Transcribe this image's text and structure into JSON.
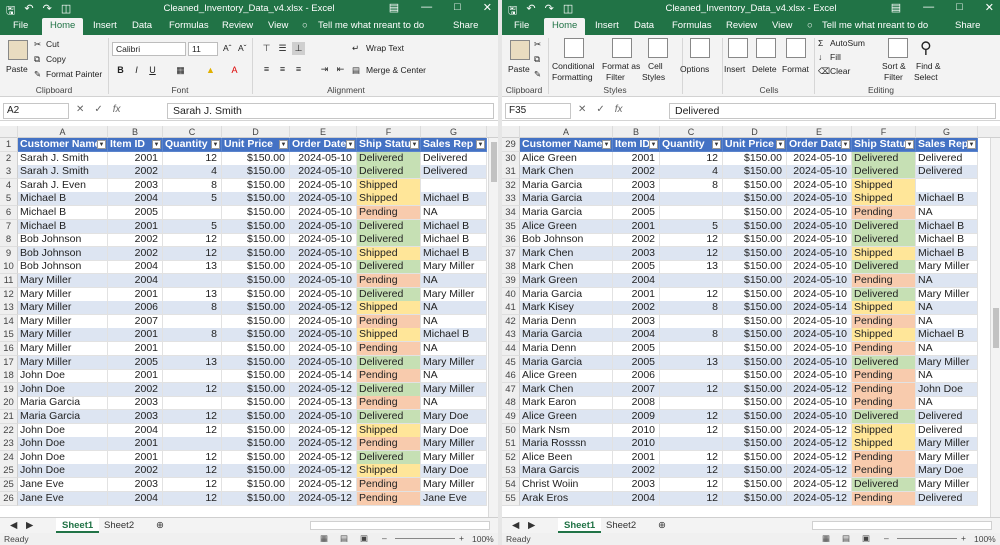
{
  "app": {
    "title": "Cleaned_Inventory_Data_v4.xlsx - Excel",
    "tabs": [
      "File",
      "Home",
      "Insert",
      "Data",
      "Formulas",
      "Review",
      "View"
    ],
    "tabs_right": [
      "File",
      "Home",
      "Insert",
      "Data",
      "Formulas",
      "Review",
      "View"
    ],
    "tell_me": "Tell me what nreant to do",
    "share": "Share",
    "status_ready": "Ready",
    "zoom": "100%",
    "sheet_tabs": [
      "Sheet1",
      "Sheet2"
    ]
  },
  "ribbon_left": {
    "paste": "Paste",
    "cut": "Cut",
    "copy": "Copy",
    "format_painter": "Format Painter",
    "clipboard": "Clipboard",
    "font_name": "Calibri",
    "font_size": "11",
    "font": "Font",
    "wrap_text": "Wrap Text",
    "merge_center": "Merge & Center",
    "alignment": "Alignment",
    "bold": "B",
    "italic": "I",
    "underline": "U"
  },
  "ribbon_right": {
    "paste": "Paste",
    "clipboard": "Clipboard",
    "conditional": "Conditional",
    "formatting": "Formatting",
    "format_as": "Format as",
    "filter": "Filter",
    "cell": "Cell",
    "styles_btn": "Styles",
    "styles": "Styles",
    "options": "Options",
    "insert": "Insert",
    "delete": "Delete",
    "format": "Format",
    "cells": "Cells",
    "autosum": "AutoSum",
    "fill": "Fill",
    "clear": "Clear",
    "sort": "Sort &",
    "filter2": "Filter",
    "find": "Find &",
    "select": "Select",
    "editing": "Editing"
  },
  "left_pane": {
    "name_box": "A2",
    "formula_value": "Sarah J. Smith",
    "columns": [
      "A",
      "B",
      "C",
      "D",
      "E",
      "F",
      "G"
    ],
    "headers": [
      "Customer Name",
      "Item ID",
      "Quantity",
      "Unit Price",
      "Order Date",
      "Ship Status",
      "Sales Rep"
    ],
    "rows": [
      {
        "n": "2",
        "name": "Sarah J. Smith",
        "id": "2001",
        "qty": "12",
        "price": "$150.00",
        "date": "2024-05-10",
        "status": "Delivered",
        "rep": "Delivered"
      },
      {
        "n": "3",
        "name": "Sarah J. Smith",
        "id": "2002",
        "qty": "4",
        "price": "$150.00",
        "date": "2024-05-10",
        "status": "Delivered",
        "rep": "Delivered"
      },
      {
        "n": "4",
        "name": "Sarah J. Even",
        "id": "2003",
        "qty": "8",
        "price": "$150.00",
        "date": "2024-05-10",
        "status": "Shipped",
        "rep": ""
      },
      {
        "n": "5",
        "name": "Michael B",
        "id": "2004",
        "qty": "5",
        "price": "$150.00",
        "date": "2024-05-10",
        "status": "Shipped",
        "rep": "Michael B"
      },
      {
        "n": "6",
        "name": "Michael B",
        "id": "2005",
        "qty": "",
        "price": "$150.00",
        "date": "2024-05-10",
        "status": "Pending",
        "rep": "NA"
      },
      {
        "n": "7",
        "name": "Michael B",
        "id": "2001",
        "qty": "5",
        "price": "$150.00",
        "date": "2024-05-10",
        "status": "Delivered",
        "rep": "Michael B"
      },
      {
        "n": "8",
        "name": "Bob Johnson",
        "id": "2002",
        "qty": "12",
        "price": "$150.00",
        "date": "2024-05-10",
        "status": "Delivered",
        "rep": "Michael B"
      },
      {
        "n": "9",
        "name": "Bob Johnson",
        "id": "2002",
        "qty": "12",
        "price": "$150.00",
        "date": "2024-05-10",
        "status": "Shipped",
        "rep": "Michael B"
      },
      {
        "n": "10",
        "name": "Bob Johnson",
        "id": "2004",
        "qty": "13",
        "price": "$150.00",
        "date": "2024-05-10",
        "status": "Delivered",
        "rep": "Mary Miller"
      },
      {
        "n": "11",
        "name": "Mary Miller",
        "id": "2004",
        "qty": "",
        "price": "$150.00",
        "date": "2024-05-10",
        "status": "Pending",
        "rep": "NA"
      },
      {
        "n": "12",
        "name": "Mary Miller",
        "id": "2001",
        "qty": "13",
        "price": "$150.00",
        "date": "2024-05-10",
        "status": "Delivered",
        "rep": "Mary Miller"
      },
      {
        "n": "13",
        "name": "Mary Miller",
        "id": "2006",
        "qty": "8",
        "price": "$150.00",
        "date": "2024-05-12",
        "status": "Shipped",
        "rep": "NA"
      },
      {
        "n": "14",
        "name": "Mary Miller",
        "id": "2007",
        "qty": "",
        "price": "$150.00",
        "date": "2024-05-10",
        "status": "Pending",
        "rep": "NA"
      },
      {
        "n": "15",
        "name": "Mary Miller",
        "id": "2001",
        "qty": "8",
        "price": "$150.00",
        "date": "2024-05-10",
        "status": "Shipped",
        "rep": "Michael B"
      },
      {
        "n": "16",
        "name": "Mary Miller",
        "id": "2001",
        "qty": "",
        "price": "$150.00",
        "date": "2024-05-10",
        "status": "Pending",
        "rep": "NA"
      },
      {
        "n": "17",
        "name": "Mary Miller",
        "id": "2005",
        "qty": "13",
        "price": "$150.00",
        "date": "2024-05-10",
        "status": "Delivered",
        "rep": "Mary Miller"
      },
      {
        "n": "18",
        "name": "John Doe",
        "id": "2001",
        "qty": "",
        "price": "$150.00",
        "date": "2024-05-14",
        "status": "Pending",
        "rep": "NA"
      },
      {
        "n": "19",
        "name": "John Doe",
        "id": "2002",
        "qty": "12",
        "price": "$150.00",
        "date": "2024-05-12",
        "status": "Delivered",
        "rep": "Mary Miller"
      },
      {
        "n": "20",
        "name": "Maria Garcia",
        "id": "2003",
        "qty": "",
        "price": "$150.00",
        "date": "2024-05-13",
        "status": "Pending",
        "rep": "NA"
      },
      {
        "n": "21",
        "name": "Maria Garcia",
        "id": "2003",
        "qty": "12",
        "price": "$150.00",
        "date": "2024-05-10",
        "status": "Delivered",
        "rep": "Mary Doe"
      },
      {
        "n": "22",
        "name": "John Doe",
        "id": "2004",
        "qty": "12",
        "price": "$150.00",
        "date": "2024-05-12",
        "status": "Shipped",
        "rep": "Mary Doe"
      },
      {
        "n": "23",
        "name": "John Doe",
        "id": "2001",
        "qty": "",
        "price": "$150.00",
        "date": "2024-05-12",
        "status": "Pending",
        "rep": "Mary Miller"
      },
      {
        "n": "24",
        "name": "John Doe",
        "id": "2001",
        "qty": "12",
        "price": "$150.00",
        "date": "2024-05-12",
        "status": "Delivered",
        "rep": "Mary Miller"
      },
      {
        "n": "25",
        "name": "John Doe",
        "id": "2002",
        "qty": "12",
        "price": "$150.00",
        "date": "2024-05-12",
        "status": "Shipped",
        "rep": "Mary Doe"
      },
      {
        "n": "25",
        "name": "Jane Eve",
        "id": "2003",
        "qty": "12",
        "price": "$150.00",
        "date": "2024-05-12",
        "status": "Pending",
        "rep": "Mary Miller"
      },
      {
        "n": "26",
        "name": "Jane Eve",
        "id": "2004",
        "qty": "12",
        "price": "$150.00",
        "date": "2024-05-12",
        "status": "Pending",
        "rep": "Jane Eve"
      }
    ]
  },
  "right_pane": {
    "name_box": "F35",
    "formula_value": "Delivered",
    "columns": [
      "A",
      "B",
      "C",
      "D",
      "E",
      "F",
      "G"
    ],
    "headers": [
      "Customer Name",
      "Item ID",
      "Quantity",
      "Unit Price",
      "Order Date",
      "Ship Status",
      "Sales Rep"
    ],
    "rows": [
      {
        "n": "30",
        "name": "Alice Green",
        "id": "2001",
        "qty": "12",
        "price": "$150.00",
        "date": "2024-05-10",
        "status": "Delivered",
        "rep": "Delivered"
      },
      {
        "n": "31",
        "name": "Mark Chen",
        "id": "2002",
        "qty": "4",
        "price": "$150.00",
        "date": "2024-05-10",
        "status": "Delivered",
        "rep": "Delivered"
      },
      {
        "n": "32",
        "name": "Maria Garcia",
        "id": "2003",
        "qty": "8",
        "price": "$150.00",
        "date": "2024-05-10",
        "status": "Shipped",
        "rep": ""
      },
      {
        "n": "33",
        "name": "Maria Garcia",
        "id": "2004",
        "qty": "",
        "price": "$150.00",
        "date": "2024-05-10",
        "status": "Shipped",
        "rep": "Michael B"
      },
      {
        "n": "34",
        "name": "Maria Garcia",
        "id": "2005",
        "qty": "",
        "price": "$150.00",
        "date": "2024-05-10",
        "status": "Pending",
        "rep": "NA"
      },
      {
        "n": "35",
        "name": "Alice Green",
        "id": "2001",
        "qty": "5",
        "price": "$150.00",
        "date": "2024-05-10",
        "status": "Delivered",
        "rep": "Michael B"
      },
      {
        "n": "36",
        "name": "Bob Johnson",
        "id": "2002",
        "qty": "12",
        "price": "$150.00",
        "date": "2024-05-10",
        "status": "Delivered",
        "rep": "Michael B"
      },
      {
        "n": "37",
        "name": "Mark Chen",
        "id": "2003",
        "qty": "12",
        "price": "$150.00",
        "date": "2024-05-10",
        "status": "Shipped",
        "rep": "Michael B"
      },
      {
        "n": "38",
        "name": "Mark Chen",
        "id": "2005",
        "qty": "13",
        "price": "$150.00",
        "date": "2024-05-10",
        "status": "Delivered",
        "rep": "Mary Miller"
      },
      {
        "n": "39",
        "name": "Mark Green",
        "id": "2004",
        "qty": "",
        "price": "$150.00",
        "date": "2024-05-10",
        "status": "Pending",
        "rep": "NA"
      },
      {
        "n": "40",
        "name": "Maria Garcia",
        "id": "2001",
        "qty": "12",
        "price": "$150.00",
        "date": "2024-05-10",
        "status": "Delivered",
        "rep": "Mary Miller"
      },
      {
        "n": "41",
        "name": "Mark Kisey",
        "id": "2002",
        "qty": "8",
        "price": "$150.00",
        "date": "2024-05-14",
        "status": "Shipped",
        "rep": "NA"
      },
      {
        "n": "42",
        "name": "Maria Denn",
        "id": "2003",
        "qty": "",
        "price": "$150.00",
        "date": "2024-05-10",
        "status": "Pending",
        "rep": "NA"
      },
      {
        "n": "43",
        "name": "Maria Garcia",
        "id": "2004",
        "qty": "8",
        "price": "$150.00",
        "date": "2024-05-10",
        "status": "Shipped",
        "rep": "Michael B"
      },
      {
        "n": "44",
        "name": "Maria Denn",
        "id": "2005",
        "qty": "",
        "price": "$150.00",
        "date": "2024-05-10",
        "status": "Pending",
        "rep": "NA"
      },
      {
        "n": "45",
        "name": "Maria Garcia",
        "id": "2005",
        "qty": "13",
        "price": "$150.00",
        "date": "2024-05-10",
        "status": "Delivered",
        "rep": "Mary Miller"
      },
      {
        "n": "46",
        "name": "Alice Green",
        "id": "2006",
        "qty": "",
        "price": "$150.00",
        "date": "2024-05-10",
        "status": "Pending",
        "rep": "NA"
      },
      {
        "n": "47",
        "name": "Mark Chen",
        "id": "2007",
        "qty": "12",
        "price": "$150.00",
        "date": "2024-05-12",
        "status": "Pending",
        "rep": "John Doe"
      },
      {
        "n": "48",
        "name": "Mark Earon",
        "id": "2008",
        "qty": "",
        "price": "$150.00",
        "date": "2024-05-10",
        "status": "Pending",
        "rep": "NA"
      },
      {
        "n": "49",
        "name": "Alice Green",
        "id": "2009",
        "qty": "12",
        "price": "$150.00",
        "date": "2024-05-10",
        "status": "Delivered",
        "rep": "Delivered"
      },
      {
        "n": "50",
        "name": "Mark Nsm",
        "id": "2010",
        "qty": "12",
        "price": "$150.00",
        "date": "2024-05-12",
        "status": "Shipped",
        "rep": "Delivered"
      },
      {
        "n": "51",
        "name": "Maria Rosssn",
        "id": "2010",
        "qty": "",
        "price": "$150.00",
        "date": "2024-05-12",
        "status": "Shipped",
        "rep": "Mary Miller"
      },
      {
        "n": "52",
        "name": "Alice Been",
        "id": "2001",
        "qty": "12",
        "price": "$150.00",
        "date": "2024-05-12",
        "status": "Pending",
        "rep": "Mary Miller"
      },
      {
        "n": "53",
        "name": "Mara Garcis",
        "id": "2002",
        "qty": "12",
        "price": "$150.00",
        "date": "2024-05-12",
        "status": "Pending",
        "rep": "Mary Doe"
      },
      {
        "n": "54",
        "name": "Christ Woiin",
        "id": "2003",
        "qty": "12",
        "price": "$150.00",
        "date": "2024-05-12",
        "status": "Delivered",
        "rep": "Mary Miller"
      },
      {
        "n": "55",
        "name": "Arak Eros",
        "id": "2004",
        "qty": "12",
        "price": "$150.00",
        "date": "2024-05-12",
        "status": "Pending",
        "rep": "Delivered"
      }
    ]
  }
}
